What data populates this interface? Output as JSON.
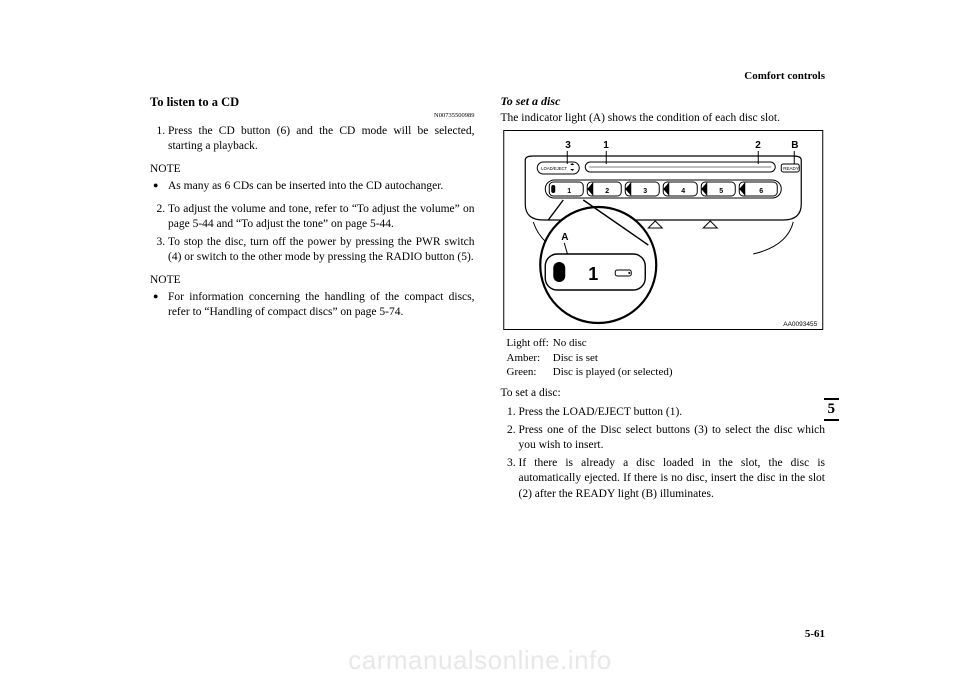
{
  "header": {
    "section": "Comfort controls"
  },
  "left": {
    "heading": "To listen to a CD",
    "code": "N00735500989",
    "steps1": [
      "Press the CD button (6) and the CD mode will be selected, starting a playback."
    ],
    "note_label": "NOTE",
    "note1_items": [
      "As many as 6 CDs can be inserted into the CD autochanger."
    ],
    "steps2_start": 2,
    "steps2": [
      "To adjust the volume and tone, refer to “To adjust the volume” on page 5-44 and “To adjust the tone” on page 5-44.",
      "To stop the disc, turn off the power by pressing the PWR switch (4) or switch to the other mode by pressing the RADIO button (5)."
    ],
    "note2_items": [
      "For information concerning the handling of the compact discs, refer to “Handling of compact discs” on page 5-74."
    ]
  },
  "right": {
    "heading": "To set a disc",
    "subline": "The indicator light (A) shows the condition of each disc slot.",
    "figure": {
      "callout_top_left1": "3",
      "callout_top_left2": "1",
      "callout_top_right1": "2",
      "callout_top_right2": "B",
      "btn_label": "LOAD/EJECT",
      "ready_label": "READY",
      "disc_numbers": [
        "1",
        "2",
        "3",
        "4",
        "5",
        "6"
      ],
      "inset_label": "A",
      "inset_slot": "1",
      "imgcode": "AA0093455"
    },
    "legend": [
      {
        "k": "Light off:",
        "v": "No disc"
      },
      {
        "k": "Amber:",
        "v": "Disc is set"
      },
      {
        "k": "Green:",
        "v": "Disc is played (or selected)"
      }
    ],
    "lead": "To set a disc:",
    "steps": [
      "Press the LOAD/EJECT button (1).",
      "Press one of the Disc select buttons (3) to select the disc which you wish to insert.",
      "If there is already a disc loaded in the slot, the disc is automatically ejected. If there is no disc, insert the disc in the slot (2) after the READY light (B) illuminates."
    ]
  },
  "sectiontab": "5",
  "pagenum": "5-61",
  "watermark": "carmanualsonline.info"
}
